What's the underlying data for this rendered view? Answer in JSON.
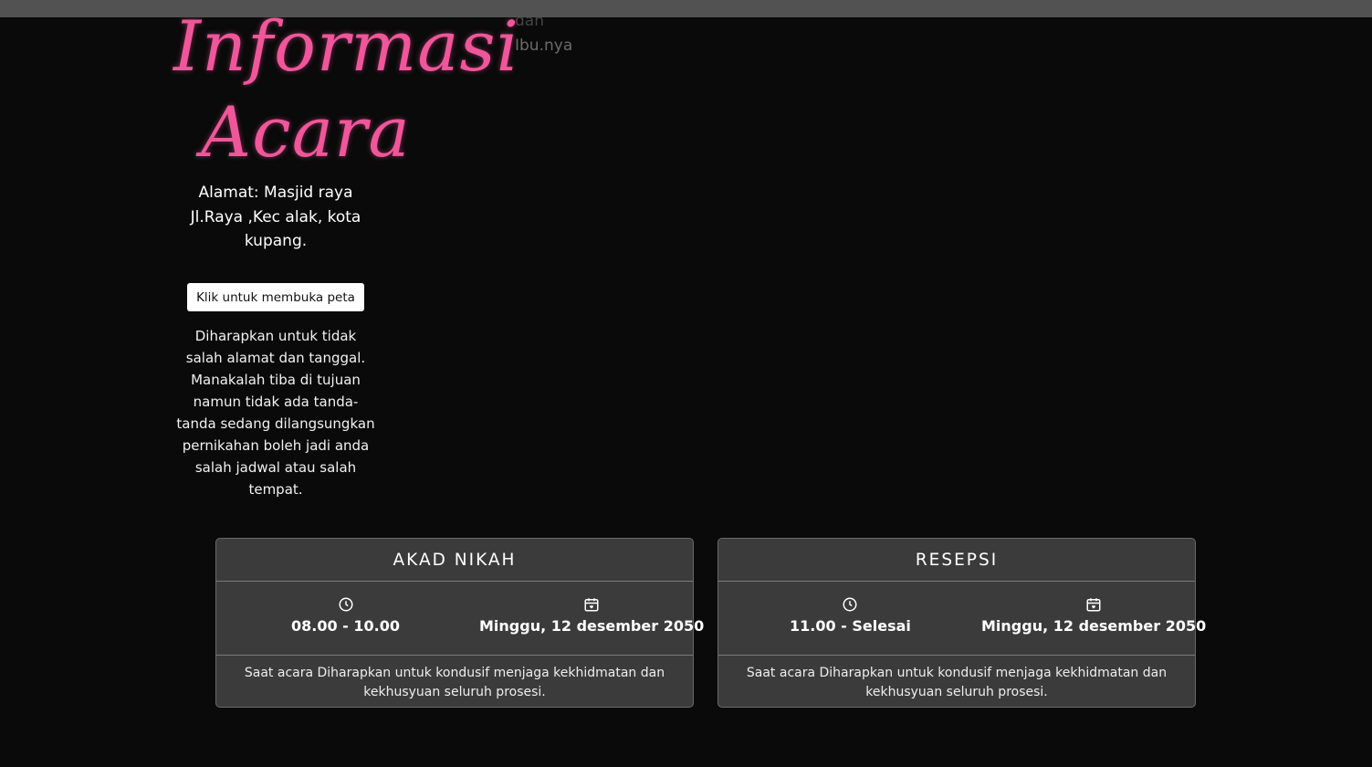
{
  "header": {
    "parents_partial": "dan",
    "parents_line": "Ibu.nya"
  },
  "section": {
    "title_line1": "Informasi",
    "title_line2": "Acara",
    "address": "Alamat: Masjid raya Jl.Raya ,Kec alak, kota kupang.",
    "map_button": "Klik untuk membuka peta",
    "notice": "Diharapkan untuk tidak salah alamat dan tanggal. Manakalah tiba di tujuan namun tidak ada tanda-tanda sedang dilangsungkan pernikahan boleh jadi anda salah jadwal atau salah tempat."
  },
  "events": [
    {
      "title": "AKAD NIKAH",
      "time": "08.00 - 10.00",
      "date": "Minggu, 12 desember 2050",
      "note": "Saat acara Diharapkan untuk kondusif menjaga kekhidmatan dan kekhusyuan seluruh prosesi."
    },
    {
      "title": "RESEPSI",
      "time": "11.00 - Selesai",
      "date": "Minggu, 12 desember 2050",
      "note": "Saat acara Diharapkan untuk kondusif menjaga kekhidmatan dan kekhusyuan seluruh prosesi."
    }
  ],
  "icons": {
    "time": "clock-icon",
    "date": "calendar-heart-icon"
  },
  "colors": {
    "background": "#0a0a0a",
    "accent": "#f0569a",
    "card": "#3b3b3b",
    "top_bar": "#525252"
  }
}
